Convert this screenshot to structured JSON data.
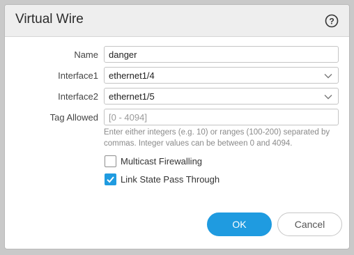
{
  "dialog": {
    "title": "Virtual Wire",
    "help_icon": "question-circle-icon"
  },
  "form": {
    "name": {
      "label": "Name",
      "value": "danger"
    },
    "interface1": {
      "label": "Interface1",
      "value": "ethernet1/4",
      "icon": "chevron-down-icon"
    },
    "interface2": {
      "label": "Interface2",
      "value": "ethernet1/5",
      "icon": "chevron-down-icon"
    },
    "tag_allowed": {
      "label": "Tag Allowed",
      "placeholder": "[0 - 4094]",
      "hint": "Enter either integers (e.g. 10) or ranges (100-200) separated by commas. Integer values can be between 0 and 4094."
    },
    "multicast_firewalling": {
      "label": "Multicast Firewalling",
      "checked": false
    },
    "link_state_pass_through": {
      "label": "Link State Pass Through",
      "checked": true
    }
  },
  "buttons": {
    "ok_label": "OK",
    "cancel_label": "Cancel"
  },
  "colors": {
    "accent": "#1f9be0",
    "header_bg": "#eeeeee",
    "backdrop": "#c9c9c9"
  }
}
